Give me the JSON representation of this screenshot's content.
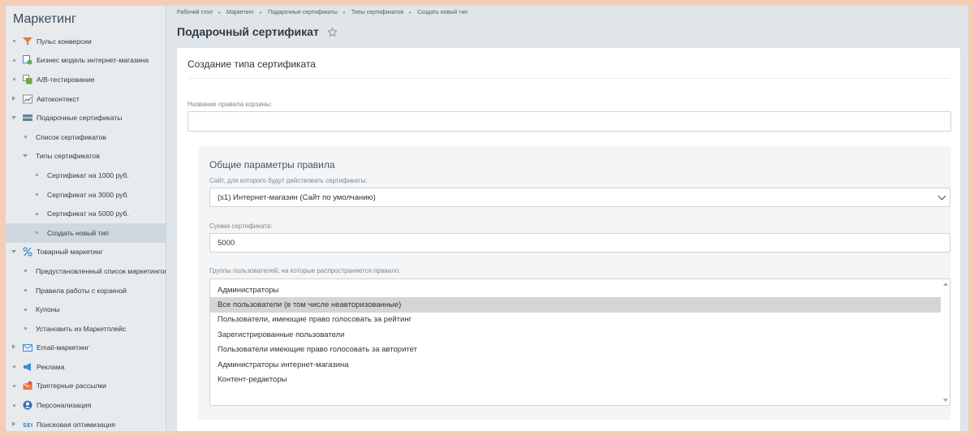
{
  "sidebar": {
    "title": "Маркетинг",
    "items": [
      {
        "label": "Пульс конверсии",
        "level": 0,
        "marker": "bullet",
        "icon": "funnel-icon",
        "color": "#e87b3c"
      },
      {
        "label": "Бизнес модель интернет-магазина",
        "level": 0,
        "marker": "bullet",
        "icon": "business-model-icon",
        "color": "#3b8fd1"
      },
      {
        "label": "A/B-тестирование",
        "level": 0,
        "marker": "bullet",
        "icon": "ab-test-icon",
        "color": "#6aa84f"
      },
      {
        "label": "Автоконтекст",
        "level": 0,
        "marker": "arrow-right",
        "icon": "chart-icon",
        "color": "#5b7fa6"
      },
      {
        "label": "Подарочные сертификаты",
        "level": 0,
        "marker": "arrow-down",
        "icon": "gift-card-icon",
        "color": "#d9534f"
      },
      {
        "label": "Список сертификатов",
        "level": 1,
        "marker": "bullet"
      },
      {
        "label": "Типы сертификатов",
        "level": 1,
        "marker": "arrow-down"
      },
      {
        "label": "Сертификат на 1000 руб.",
        "level": 2,
        "marker": "bullet"
      },
      {
        "label": "Сертификат на 3000 руб.",
        "level": 2,
        "marker": "bullet"
      },
      {
        "label": "Сертификат на 5000 руб.",
        "level": 2,
        "marker": "bullet"
      },
      {
        "label": "Создать новый тип",
        "level": 2,
        "marker": "bullet",
        "active": true
      },
      {
        "label": "Товарный маркетинг",
        "level": 0,
        "marker": "arrow-down",
        "icon": "percent-icon",
        "color": "#3b8fd1"
      },
      {
        "label": "Предустановленный список маркетингов",
        "level": 1,
        "marker": "bullet"
      },
      {
        "label": "Правила работы с корзиной",
        "level": 1,
        "marker": "bullet"
      },
      {
        "label": "Купоны",
        "level": 1,
        "marker": "bullet"
      },
      {
        "label": "Установить из Маркетплейс",
        "level": 1,
        "marker": "bullet"
      },
      {
        "label": "Email-маркетинг",
        "level": 0,
        "marker": "arrow-right",
        "icon": "email-icon",
        "color": "#3b8fd1"
      },
      {
        "label": "Реклама",
        "level": 0,
        "marker": "bullet",
        "icon": "megaphone-icon",
        "color": "#3b8fd1"
      },
      {
        "label": "Триггерные рассылки",
        "level": 0,
        "marker": "bullet",
        "icon": "trigger-icon",
        "color": "#e87b3c"
      },
      {
        "label": "Персонализация",
        "level": 0,
        "marker": "bullet",
        "icon": "personalization-icon",
        "color": "#2f6db3"
      },
      {
        "label": "Поисковая оптимизация",
        "level": 0,
        "marker": "arrow-right",
        "icon": "seo-icon",
        "color": "#3b8fd1"
      }
    ]
  },
  "breadcrumb": [
    "Рабочий стол",
    "Маркетинг",
    "Подарочные сертификаты",
    "Типы сертификатов",
    "Создать новый тип"
  ],
  "page": {
    "title": "Подарочный сертификат"
  },
  "form": {
    "title": "Создание типа сертификата",
    "rule_name_label": "Название правила корзины:",
    "rule_name_value": "",
    "general": {
      "title": "Общие параметры правила",
      "site_label": "Сайт, для которого будут действовать сертификаты:",
      "site_value": "(s1) Интернет-магазин (Сайт по умолчанию)",
      "amount_label": "Сумма сертификата:",
      "amount_value": "5000",
      "groups_label": "Группы пользователей, на которые распространяется правило:",
      "groups": [
        {
          "label": "Администраторы",
          "selected": false
        },
        {
          "label": "Все пользователи (в том числе неавторизованные)",
          "selected": true
        },
        {
          "label": "Пользователи, имеющие право голосовать за рейтинг",
          "selected": false
        },
        {
          "label": "Зарегистрированные пользователи",
          "selected": false
        },
        {
          "label": "Пользователи имеющие право голосовать за авторитет",
          "selected": false
        },
        {
          "label": "Администраторы интернет-магазина",
          "selected": false
        },
        {
          "label": "Контент-редакторы",
          "selected": false
        }
      ]
    }
  }
}
